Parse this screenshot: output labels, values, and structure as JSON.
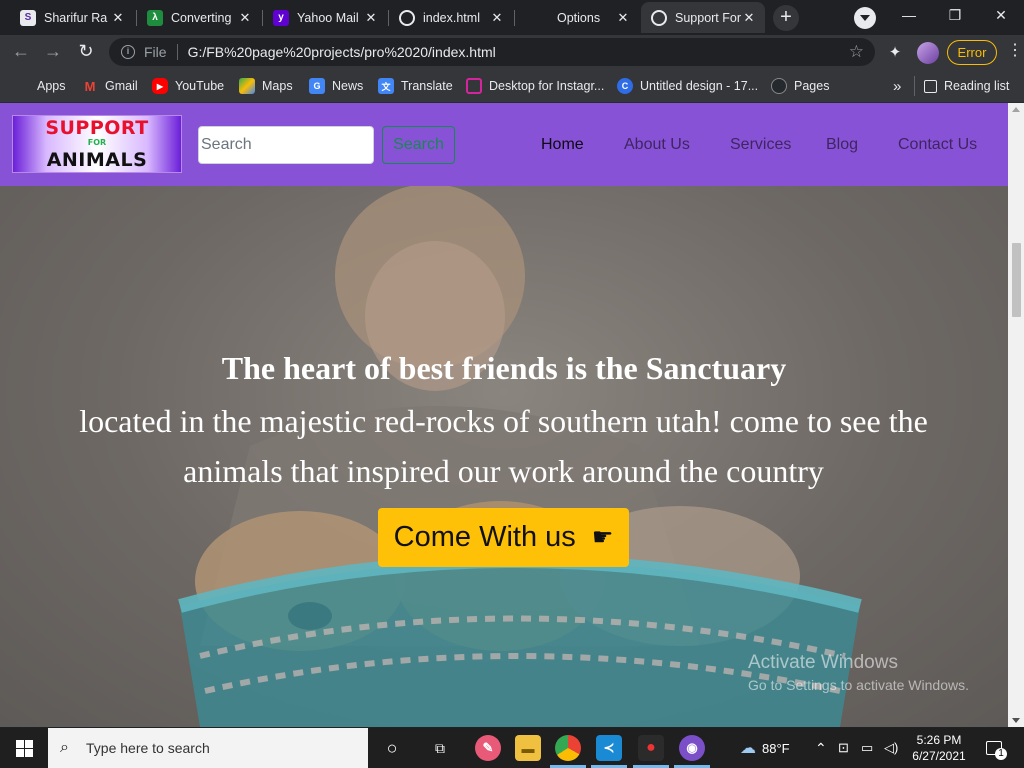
{
  "browser": {
    "tabs": [
      {
        "title": "Sharifur Ra",
        "fav_color": "#e8eaed",
        "fav_text": "S"
      },
      {
        "title": "Converting",
        "fav_color": "#1e8e3e",
        "fav_text": "λ"
      },
      {
        "title": "Yahoo Mail",
        "fav_color": "#5f01d1",
        "fav_text": "y"
      },
      {
        "title": "index.html",
        "fav_color": "#5f6368",
        "fav_text": "◍"
      },
      {
        "title": "Options",
        "fav_color": "",
        "fav_text": ""
      },
      {
        "title": "Support For",
        "fav_color": "#5f6368",
        "fav_text": "◍"
      }
    ],
    "close_glyph": "✕",
    "new_tab": "+",
    "window_controls": {
      "minimize": "—",
      "maximize": "❐",
      "close": "✕"
    },
    "omnibox": {
      "scheme_label": "File",
      "url": "G:/FB%20page%20projects/pro%2020/index.html"
    },
    "error_label": "Error",
    "bookmarks": [
      {
        "label": "Apps",
        "color": "#ea4335",
        "glyph": ""
      },
      {
        "label": "Gmail",
        "color": "#ffffff",
        "glyph": "M"
      },
      {
        "label": "YouTube",
        "color": "#ff0000",
        "glyph": "▶"
      },
      {
        "label": "Maps",
        "color": "#34a853",
        "glyph": "◆"
      },
      {
        "label": "News",
        "color": "#4285f4",
        "glyph": "G"
      },
      {
        "label": "Translate",
        "color": "#4285f4",
        "glyph": "文"
      },
      {
        "label": "Desktop for Instagr...",
        "color": "#d6249f",
        "glyph": "◘"
      },
      {
        "label": "Untitled design - 17...",
        "color": "#2e6de5",
        "glyph": "C"
      },
      {
        "label": "Pages",
        "color": "#24292e",
        "glyph": "●"
      }
    ],
    "overflow": "»",
    "reading_list": "Reading list"
  },
  "site": {
    "logo": {
      "line1": "SUPPORT",
      "line2": "FOR",
      "line3": "ANIMALS"
    },
    "search_placeholder": "Search",
    "search_button": "Search",
    "nav": [
      "Home",
      "About Us",
      "Services",
      "Blog",
      "Contact Us"
    ],
    "hero": {
      "heading": "The heart of best friends is the Sanctuary",
      "text": "located in the majestic red-rocks of southern utah! come to see the animals that inspired our work around the country",
      "button": "Come With us",
      "button_icon": "pointing-hand-icon"
    },
    "watermark": {
      "line1": "Activate Windows",
      "line2": "Go to Settings to activate Windows."
    }
  },
  "taskbar": {
    "search_placeholder": "Type here to search",
    "weather": "88°F",
    "time": "5:26 PM",
    "date": "6/27/2021",
    "notifications": "1"
  }
}
